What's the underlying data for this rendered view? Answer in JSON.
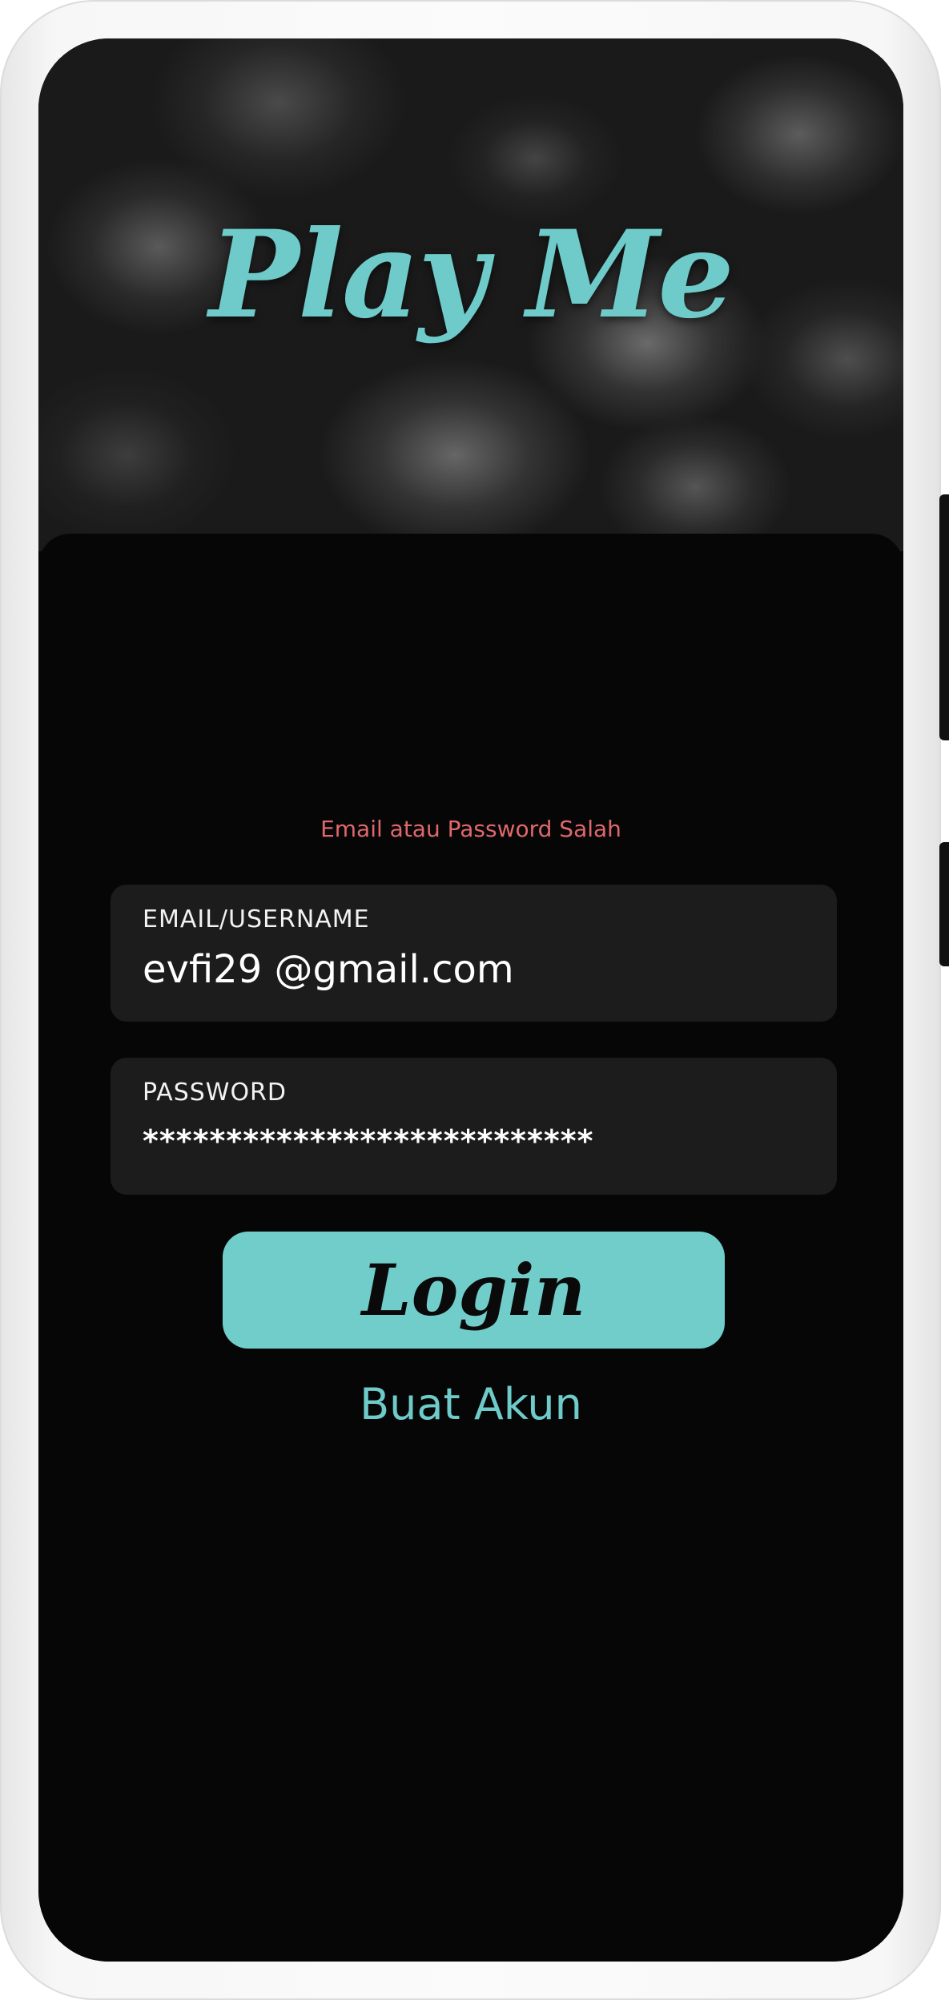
{
  "app": {
    "title": "Play Me"
  },
  "login": {
    "error_message": "Email atau Password Salah",
    "email_label": "EMAIL/USERNAME",
    "email_value": "evfi29 @gmail.com",
    "password_label": "PASSWORD",
    "password_value": "***************************",
    "login_button_label": "Login",
    "create_account_label": "Buat Akun"
  },
  "colors": {
    "accent": "#6ecbc9",
    "error": "#e0686b",
    "background": "#060606",
    "field_background": "#1c1c1c"
  }
}
